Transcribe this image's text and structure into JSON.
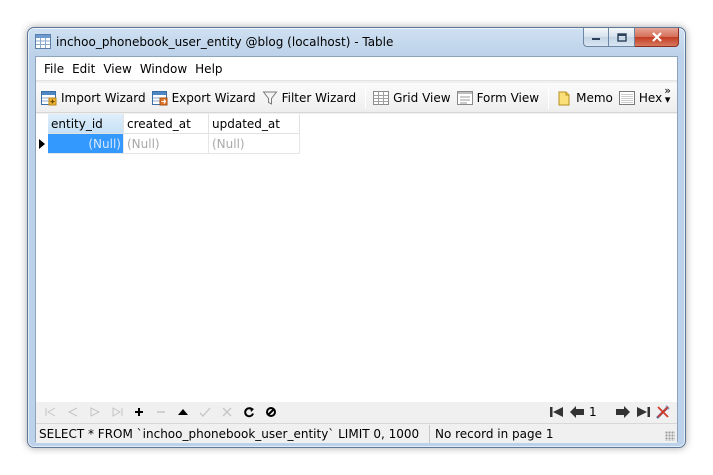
{
  "window": {
    "title": "inchoo_phonebook_user_entity @blog (localhost) - Table"
  },
  "menu": [
    "File",
    "Edit",
    "View",
    "Window",
    "Help"
  ],
  "toolbar": {
    "import_wizard": "Import Wizard",
    "export_wizard": "Export Wizard",
    "filter_wizard": "Filter Wizard",
    "grid_view": "Grid View",
    "form_view": "Form View",
    "memo": "Memo",
    "hex": "Hex",
    "more": "»"
  },
  "grid": {
    "columns": [
      "entity_id",
      "created_at",
      "updated_at"
    ],
    "rows": [
      [
        "(Null)",
        "(Null)",
        "(Null)"
      ]
    ]
  },
  "pager": {
    "page": "1"
  },
  "status": {
    "sql": "SELECT * FROM `inchoo_phonebook_user_entity` LIMIT 0, 1000",
    "record": "No record in page 1"
  },
  "icons": {
    "nav_add": "plus-icon",
    "nav_delete": "minus-icon",
    "nav_up": "up-icon",
    "nav_apply": "check-icon",
    "nav_discard": "x-icon",
    "nav_refresh": "refresh-icon",
    "nav_stop": "stop-icon"
  },
  "colors": {
    "selection": "#3399ff",
    "header_selected": "#c6e1f7",
    "null_text": "#a8a8a8"
  }
}
